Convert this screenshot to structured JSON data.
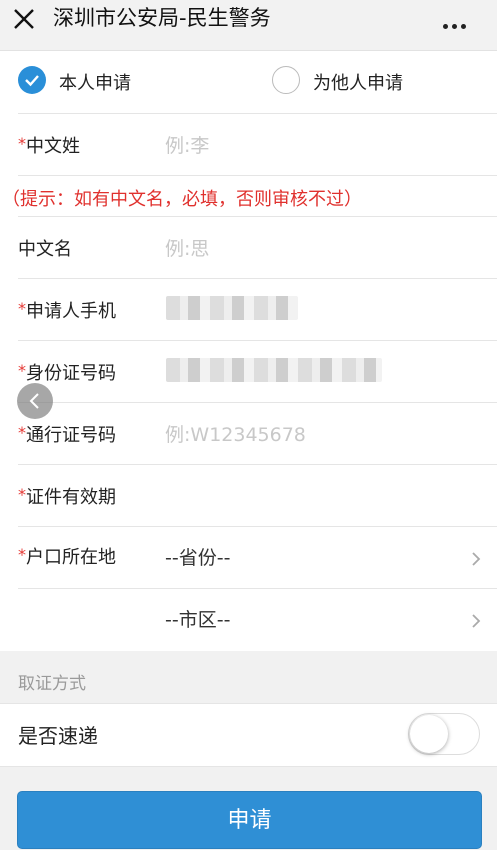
{
  "header": {
    "title": "深圳市公安局-民生警务",
    "close_icon": "close-icon",
    "more_icon": "more-icon"
  },
  "applicant": {
    "self_label": "本人申请",
    "self_selected": true,
    "other_label": "为他人申请",
    "other_selected": false
  },
  "form": {
    "surname_label": "中文姓",
    "surname_placeholder": "例:李",
    "hint": "（提示：如有中文名，必填，否则审核不过）",
    "given_name_label": "中文名",
    "given_name_placeholder": "例:思",
    "phone_label": "申请人手机",
    "id_label": "身份证号码",
    "pass_label": "通行证号码",
    "pass_placeholder": "例:W12345678",
    "validity_label": "证件有效期",
    "hukou_label": "户口所在地",
    "province_value": "--省份--",
    "city_value": "--市区--",
    "required_mark": "*"
  },
  "pickup": {
    "section_label": "取证方式",
    "express_label": "是否速递",
    "express_on": false
  },
  "submit_label": "申请",
  "colors": {
    "accent": "#2f8fd5",
    "required": "#e53935",
    "hint": "#e0312e"
  }
}
